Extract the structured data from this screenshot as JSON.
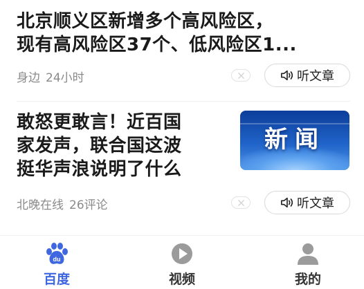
{
  "feed": {
    "items": [
      {
        "title_lines": [
          "北京顺义区新增多个高风险区，",
          "现有高风险区37个、低风险区1..."
        ],
        "source": "身边",
        "time": "24小时",
        "listen_label": "听文章"
      },
      {
        "title_lines": [
          "敢怒更敢言！近百国",
          "家发声，联合国这波",
          "挺华声浪说明了什么"
        ],
        "source": "北晚在线",
        "comments": "26评论",
        "thumbnail_text": "新闻",
        "listen_label": "听文章"
      }
    ]
  },
  "tabbar": {
    "tabs": [
      {
        "label": "百度",
        "icon": "baidu-paw-icon",
        "active": true
      },
      {
        "label": "视频",
        "icon": "play-icon",
        "active": false
      },
      {
        "label": "我的",
        "icon": "user-icon",
        "active": false
      }
    ]
  },
  "colors": {
    "accent": "#3f67e0",
    "muted_text": "#8a8a8a",
    "icon_gray": "#9b9b9b"
  }
}
